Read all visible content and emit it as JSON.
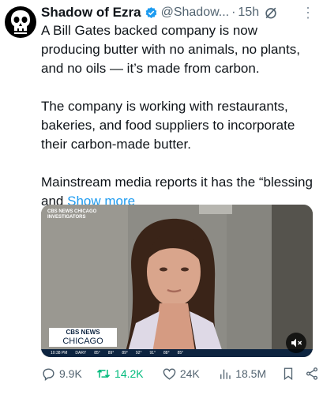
{
  "tweet": {
    "author_name": "Shadow of Ezra",
    "handle": "@Shadow...",
    "separator": "·",
    "time": "15h",
    "paragraphs": [
      "A Bill Gates backed company is now producing butter with no animals, no plants, and no oils — it’s made from carbon.",
      "The company is working with restaurants, bakeries, and food suppliers to incorporate their carbon-made butter.",
      "Mainstream media reports it has the “blessing and"
    ],
    "show_more": "Show more"
  },
  "media": {
    "top_logo_line1": "CBS NEWS CHICAGO",
    "top_logo_line2": "INVESTIGATORS",
    "station_line1": "CBS NEWS",
    "station_line2": "CHICAGO",
    "ticker_time": "10:38 PM",
    "ticker_label": "DARY",
    "ticker_temps": [
      "85°",
      "89°",
      "89°",
      "92°",
      "91°",
      "88°",
      "85°"
    ]
  },
  "actions": {
    "replies": "9.9K",
    "reposts": "14.2K",
    "likes": "24K",
    "views": "18.5M"
  },
  "colors": {
    "link": "#1d9bf0",
    "muted": "#536471",
    "repost_active": "#00ba7c",
    "verified": "#1d9bf0"
  },
  "icons": {
    "verified": "verified-badge-icon",
    "edited": "edited-icon",
    "more": "more-options-icon",
    "reply": "reply-icon",
    "repost": "repost-icon",
    "like": "heart-icon",
    "views": "views-bar-chart-icon",
    "bookmark": "bookmark-icon",
    "share": "share-icon",
    "mute": "mute-icon"
  }
}
